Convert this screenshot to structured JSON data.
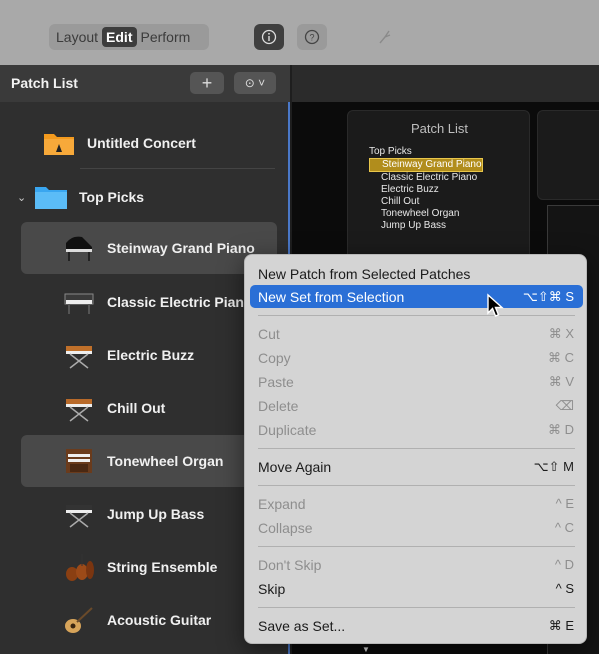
{
  "toolbar": {
    "modes": [
      "Layout",
      "Edit",
      "Perform"
    ],
    "active_mode": "Edit",
    "buttons": {
      "info": "info-icon",
      "help": "help-icon",
      "tuner": "tuning-fork-icon"
    }
  },
  "sidebar": {
    "title": "Patch List",
    "add_label": "+",
    "more_label": "⊙ ˅",
    "items": [
      {
        "label": "Untitled Concert",
        "icon": "concert-folder-icon"
      },
      {
        "label": "Top Picks",
        "icon": "folder-icon"
      },
      {
        "label": "Steinway Grand Piano",
        "icon": "grand-piano-icon"
      },
      {
        "label": "Classic Electric Pian",
        "icon": "electric-piano-icon"
      },
      {
        "label": "Electric Buzz",
        "icon": "synth-icon"
      },
      {
        "label": "Chill Out",
        "icon": "synth-icon"
      },
      {
        "label": "Tonewheel Organ",
        "icon": "organ-icon"
      },
      {
        "label": "Jump Up Bass",
        "icon": "synth-icon"
      },
      {
        "label": "String Ensemble",
        "icon": "strings-icon"
      },
      {
        "label": "Acoustic Guitar",
        "icon": "guitar-icon"
      }
    ]
  },
  "panel": {
    "title": "Patch List",
    "category": "Top Picks",
    "patches": [
      "Steinway Grand Piano",
      "Classic Electric Piano",
      "Electric Buzz",
      "Chill Out",
      "Tonewheel Organ",
      "Jump Up Bass"
    ],
    "arrows": "▲ ▼ ▲ ▼"
  },
  "context_menu": {
    "items": [
      {
        "label": "New Patch from Selected Patches",
        "shortcut": "",
        "enabled": true
      },
      {
        "label": "New Set from Selection",
        "shortcut": "⌥⇧⌘ S",
        "enabled": true,
        "highlighted": true
      },
      {
        "label": "Cut",
        "shortcut": "⌘ X",
        "enabled": false
      },
      {
        "label": "Copy",
        "shortcut": "⌘ C",
        "enabled": false
      },
      {
        "label": "Paste",
        "shortcut": "⌘ V",
        "enabled": false
      },
      {
        "label": "Delete",
        "shortcut": "⌫",
        "enabled": false
      },
      {
        "label": "Duplicate",
        "shortcut": "⌘ D",
        "enabled": false
      },
      {
        "label": "Move Again",
        "shortcut": "⌥⇧ M",
        "enabled": true
      },
      {
        "label": "Expand",
        "shortcut": "^ E",
        "enabled": false
      },
      {
        "label": "Collapse",
        "shortcut": "^ C",
        "enabled": false
      },
      {
        "label": "Don't Skip",
        "shortcut": "^ D",
        "enabled": false
      },
      {
        "label": "Skip",
        "shortcut": "^ S",
        "enabled": true
      },
      {
        "label": "Save as Set...",
        "shortcut": "⌘ E",
        "enabled": true
      }
    ]
  },
  "colors": {
    "accent": "#2a6fd6",
    "selection_gold": "#b18d1c",
    "sidebar_bg": "#2f2f2f"
  }
}
